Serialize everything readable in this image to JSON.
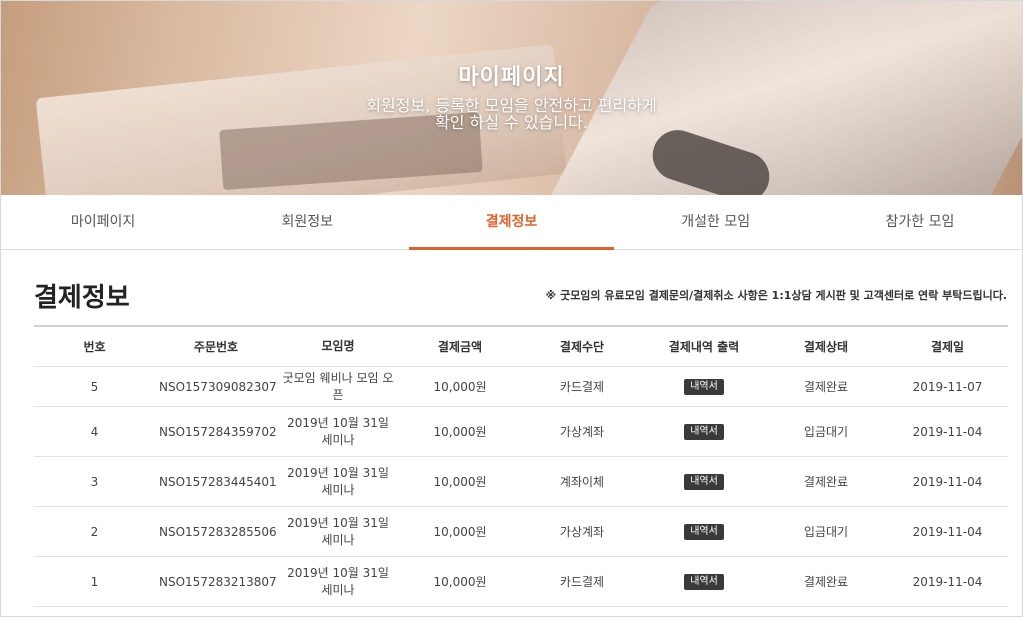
{
  "hero": {
    "title": "마이페이지",
    "subtitle_line1": "회원정보, 등록한 모임을 안전하고 편리하게",
    "subtitle_line2": "확인 하실 수 있습니다."
  },
  "tabs": [
    {
      "label": "마이페이지",
      "active": false
    },
    {
      "label": "회원정보",
      "active": false
    },
    {
      "label": "결제정보",
      "active": true
    },
    {
      "label": "개설한 모임",
      "active": false
    },
    {
      "label": "참가한 모임",
      "active": false
    }
  ],
  "section": {
    "title": "결제정보",
    "notice": "※ 굿모임의 유료모임 결제문의/결제취소 사항은 1:1상담 게시판 및 고객센터로 연락 부탁드립니다."
  },
  "table": {
    "headers": [
      "번호",
      "주문번호",
      "모임명",
      "결제금액",
      "결제수단",
      "결제내역 출력",
      "결제상태",
      "결제일"
    ],
    "receipt_label": "내역서",
    "rows": [
      {
        "no": "5",
        "order": "NSO157309082307",
        "name": "굿모임 웨비나 모임 오픈",
        "amount": "10,000원",
        "method": "카드결제",
        "status": "결제완료",
        "date": "2019-11-07"
      },
      {
        "no": "4",
        "order": "NSO157284359702",
        "name": "2019년 10월 31일 세미나",
        "amount": "10,000원",
        "method": "가상계좌",
        "status": "입금대기",
        "date": "2019-11-04"
      },
      {
        "no": "3",
        "order": "NSO157283445401",
        "name": "2019년 10월 31일 세미나",
        "amount": "10,000원",
        "method": "계좌이체",
        "status": "결제완료",
        "date": "2019-11-04"
      },
      {
        "no": "2",
        "order": "NSO157283285506",
        "name": "2019년 10월 31일 세미나",
        "amount": "10,000원",
        "method": "가상계좌",
        "status": "입금대기",
        "date": "2019-11-04"
      },
      {
        "no": "1",
        "order": "NSO157283213807",
        "name": "2019년 10월 31일 세미나",
        "amount": "10,000원",
        "method": "카드결제",
        "status": "결제완료",
        "date": "2019-11-04"
      }
    ]
  },
  "colors": {
    "accent": "#e0622a",
    "receipt_button": "#3a3a3a"
  }
}
